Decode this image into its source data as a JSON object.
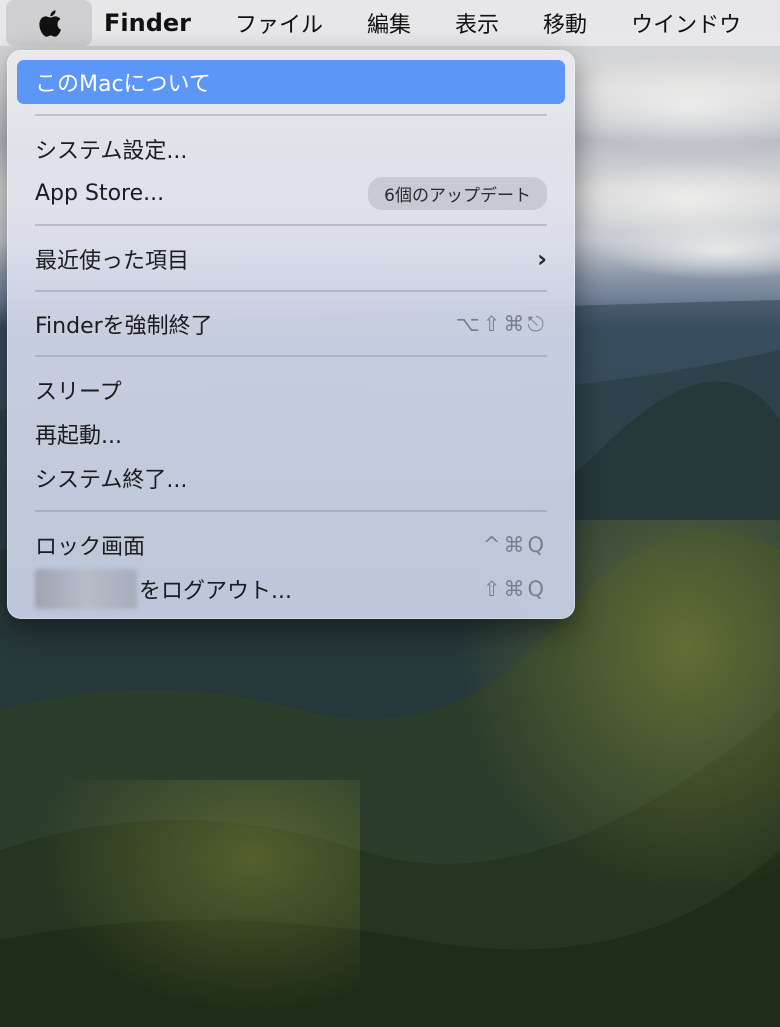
{
  "menubar": {
    "apple_icon": "apple-logo-icon",
    "app_name": "Finder",
    "menus": [
      "ファイル",
      "編集",
      "表示",
      "移動",
      "ウインドウ"
    ]
  },
  "apple_menu": {
    "about": "このMacについて",
    "system_settings": "システム設定...",
    "app_store": "App Store...",
    "app_store_badge": "6個のアップデート",
    "recent_items": "最近使った項目",
    "force_quit": "Finderを強制終了",
    "force_quit_shortcut": "⌥⇧⌘⎋",
    "sleep": "スリープ",
    "restart": "再起動...",
    "shutdown": "システム終了...",
    "lock_screen": "ロック画面",
    "lock_screen_shortcut": "^⌘Q",
    "logout": "をログアウト...",
    "logout_shortcut": "⇧⌘Q"
  },
  "colors": {
    "highlight": "#5c96f6",
    "menubar": "#e8e8ea"
  }
}
